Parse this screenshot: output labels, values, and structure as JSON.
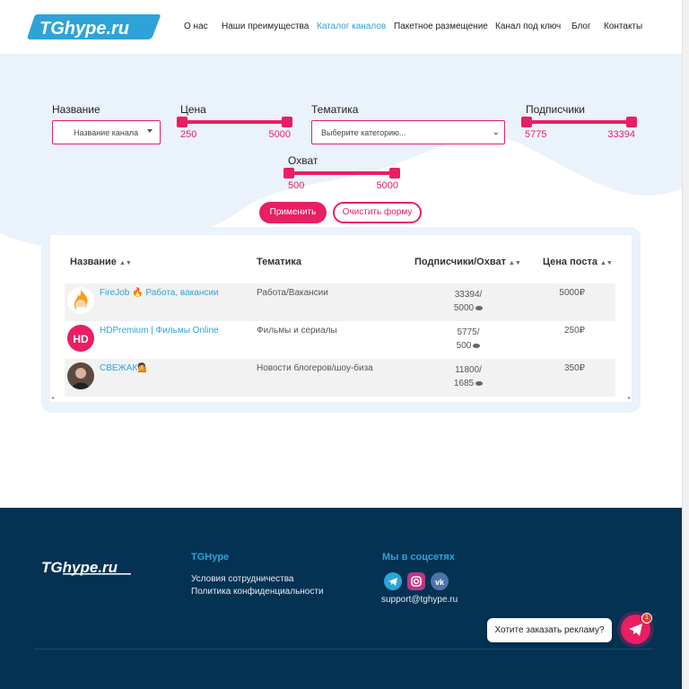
{
  "header": {
    "logo_text": "TGhype.ru",
    "nav": [
      {
        "label": "О нас",
        "active": false
      },
      {
        "label": "Наши преимущества",
        "active": false
      },
      {
        "label": "Каталог каналов",
        "active": true
      },
      {
        "label": "Пакетное размещение",
        "active": false
      },
      {
        "label": "Канал под ключ",
        "active": false
      },
      {
        "label": "Блог",
        "active": false
      },
      {
        "label": "Контакты",
        "active": false
      }
    ]
  },
  "filters": {
    "name": {
      "label": "Название",
      "placeholder": "Название канала"
    },
    "price": {
      "label": "Цена",
      "min": "250",
      "max": "5000"
    },
    "topic": {
      "label": "Тематика",
      "placeholder": "Выберите категорию..."
    },
    "subscribers": {
      "label": "Подписчики",
      "min": "5775",
      "max": "33394"
    },
    "reach": {
      "label": "Охват",
      "min": "500",
      "max": "5000"
    },
    "apply_label": "Применить",
    "clear_label": "Очистить форму"
  },
  "table": {
    "headers": {
      "name": "Название",
      "topic": "Тематика",
      "subs_reach": "Подписчики/Охват",
      "price": "Цена поста"
    },
    "rows": [
      {
        "name": "FireJob 🔥 Работа, вакансии",
        "topic": "Работа/Вакансии",
        "subs": "33394/",
        "reach": "5000",
        "price": "5000₽"
      },
      {
        "name": "HDPremium | Фильмы Online",
        "topic": "Фильмы и сериалы",
        "subs": "5775/",
        "reach": "500",
        "price": "250₽"
      },
      {
        "name": "СВЕЖАК💁",
        "topic": "Новости блогеров/шоу-биза",
        "subs": "11800/",
        "reach": "1685",
        "price": "350₽"
      }
    ]
  },
  "footer": {
    "col_tghype": {
      "title": "TGHype",
      "links": [
        "Условия сотрудничества",
        "Политика конфиденциальности"
      ]
    },
    "col_social": {
      "title": "Мы в соцсетях",
      "email": "support@tghype.ru"
    }
  },
  "chat": {
    "prompt": "Хотите заказать рекламу?",
    "badge": "1"
  },
  "colors": {
    "accent": "#e91e63",
    "link": "#2ea3d8",
    "footer_bg": "#033253"
  }
}
